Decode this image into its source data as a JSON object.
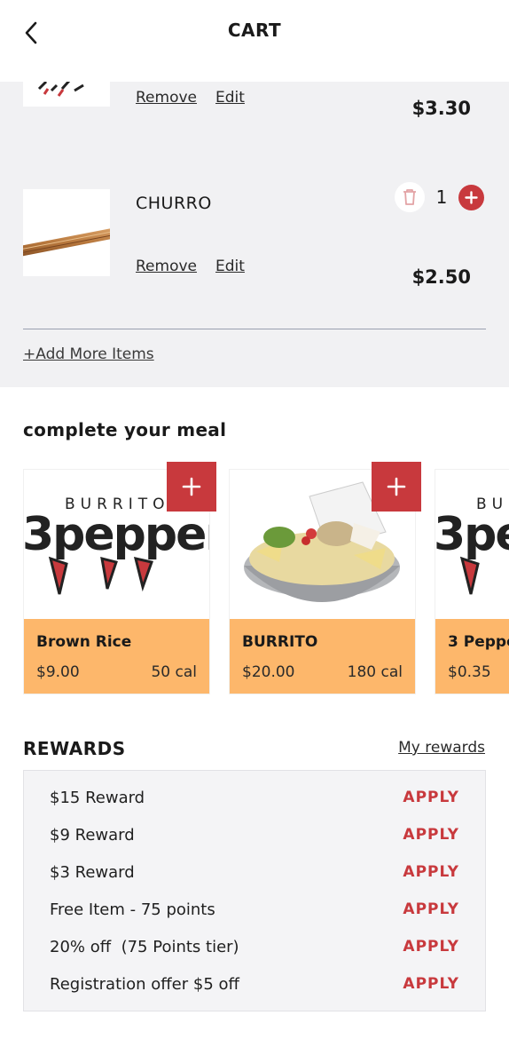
{
  "header": {
    "title": "CART"
  },
  "cart": {
    "items": [
      {
        "name": "",
        "remove_label": "Remove",
        "edit_label": "Edit",
        "price": "$3.30"
      },
      {
        "name": "CHURRO",
        "remove_label": "Remove",
        "edit_label": "Edit",
        "price": "$2.50",
        "quantity": "1"
      }
    ],
    "add_more_label": "+Add More Items"
  },
  "upsell": {
    "title": "complete your meal",
    "cards": [
      {
        "name": "Brown Rice",
        "price": "$9.00",
        "calories": "50 cal",
        "image": "burrito-3pepper-logo"
      },
      {
        "name": "BURRITO",
        "price": "$20.00",
        "calories": "180 cal",
        "image": "burrito-bowl-photo"
      },
      {
        "name": "3 Peppe",
        "price": "$0.35",
        "calories": "",
        "image": "burrito-3pepper-logo"
      }
    ],
    "logo_text": {
      "top": "BURRITO",
      "main": "3pepper"
    }
  },
  "rewards": {
    "title": "REWARDS",
    "my_rewards_label": "My rewards",
    "items": [
      {
        "label": "$15 Reward",
        "action": "APPLY"
      },
      {
        "label": "$9 Reward",
        "action": "APPLY"
      },
      {
        "label": "$3 Reward",
        "action": "APPLY"
      },
      {
        "label": "Free Item - 75 points",
        "action": "APPLY"
      },
      {
        "label": "20% off  (75 Points tier)",
        "action": "APPLY"
      },
      {
        "label": "Registration offer $5 off",
        "action": "APPLY"
      }
    ]
  },
  "colors": {
    "accent_red": "#c8393d",
    "card_orange": "#fdb76b",
    "cart_bg": "#f1f1f3"
  },
  "icons": {
    "back": "chevron-left-icon",
    "trash": "trash-icon",
    "plus": "plus-icon"
  }
}
